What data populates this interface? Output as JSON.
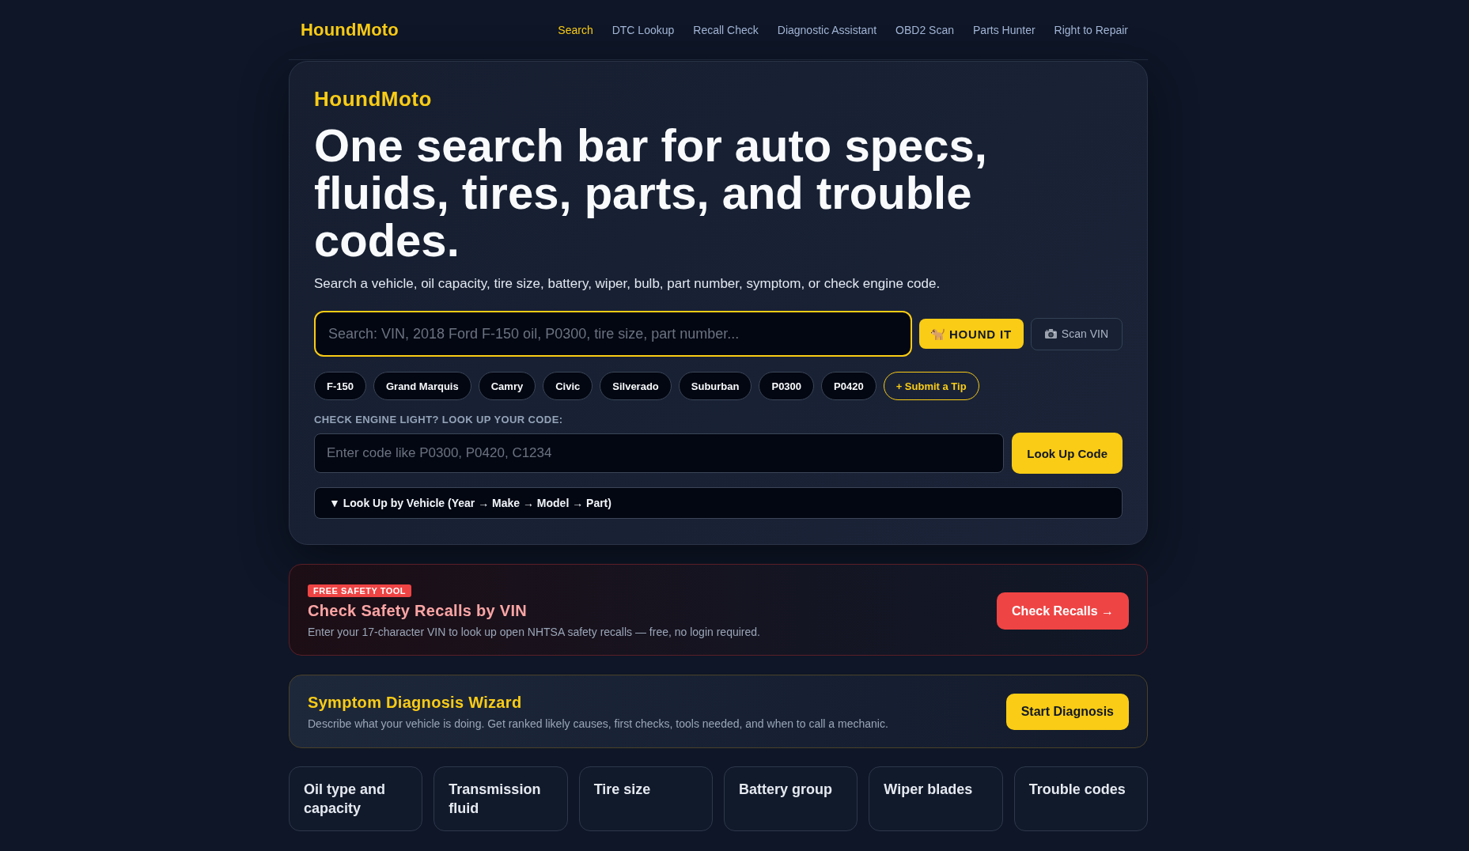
{
  "nav": {
    "logo": "HoundMoto",
    "links": [
      {
        "label": "Search",
        "selected": true
      },
      {
        "label": "DTC Lookup",
        "selected": false
      },
      {
        "label": "Recall Check",
        "selected": false
      },
      {
        "label": "Diagnostic Assistant",
        "selected": false
      },
      {
        "label": "OBD2 Scan",
        "selected": false
      },
      {
        "label": "Parts Hunter",
        "selected": false
      },
      {
        "label": "Right to Repair",
        "selected": false
      }
    ]
  },
  "hero": {
    "brand": "HoundMoto",
    "title": "One search bar for auto specs, fluids, tires, parts, and trouble codes.",
    "subtitle": "Search a vehicle, oil capacity, tire size, battery, wiper, bulb, part number, symptom, or check engine code.",
    "search": {
      "placeholder": "Search: VIN, 2018 Ford F-150 oil, P0300, tire size, part number..."
    },
    "search_buttons": [
      {
        "kind": "primary",
        "label": "HOUND IT"
      },
      {
        "kind": "secondary",
        "label": "Scan VIN"
      }
    ],
    "chips": [
      {
        "kind": "suggestion",
        "label": "F-150"
      },
      {
        "kind": "suggestion",
        "label": "Grand Marquis"
      },
      {
        "kind": "suggestion",
        "label": "Camry"
      },
      {
        "kind": "suggestion",
        "label": "Civic"
      },
      {
        "kind": "suggestion",
        "label": "Silverado"
      },
      {
        "kind": "suggestion",
        "label": "Suburban"
      },
      {
        "kind": "suggestion",
        "label": "P0300"
      },
      {
        "kind": "suggestion",
        "label": "P0420"
      },
      {
        "kind": "tip",
        "label": "+ Submit a Tip"
      }
    ],
    "code_lookup": {
      "label": "CHECK ENGINE LIGHT? LOOK UP YOUR CODE:",
      "placeholder": "Enter code like P0300, P0420, C1234",
      "button": "Look Up Code"
    },
    "vehicle_lookup": {
      "label": "▼ Look Up by Vehicle (Year → Make → Model → Part)"
    }
  },
  "promos": [
    {
      "kind": "recall",
      "badge": "FREE SAFETY TOOL",
      "title": "Check Safety Recalls by VIN",
      "description": "Enter your 17-character VIN to look up open NHTSA safety recalls — free, no login required.",
      "button": "Check Recalls →"
    },
    {
      "kind": "wizard",
      "title": "Symptom Diagnosis Wizard",
      "description": "Describe what your vehicle is doing. Get ranked likely causes, first checks, tools needed, and when to call a mechanic.",
      "button": "Start Diagnosis"
    }
  ],
  "categories": [
    "Oil type and capacity",
    "Transmission fluid",
    "Tire size",
    "Battery group",
    "Wiper blades",
    "Trouble codes"
  ]
}
